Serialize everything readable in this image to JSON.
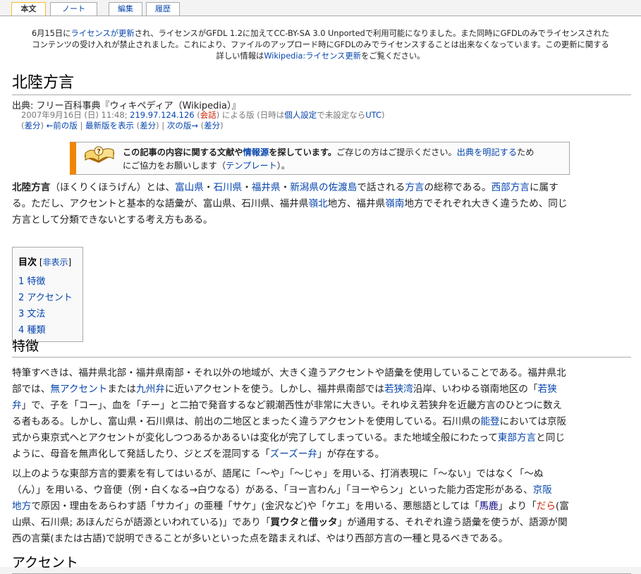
{
  "tabs": [
    {
      "label": "本文",
      "selected": true
    },
    {
      "label": "ノート",
      "selected": false
    },
    {
      "label": "編集",
      "selected": false
    },
    {
      "label": "履歴",
      "selected": false
    }
  ],
  "sitenotice": {
    "l1_a": "6月15日に",
    "l1_link1": "ライセンスが更新",
    "l1_b": "され、ライセンスがGFDL 1.2に加えてCC-BY-SA 3.0 Unportedで利用可能になりました。また同時にGFDLのみでライセンスされた",
    "l2": "コンテンツの受け入れが禁止されました。これにより、ファイルのアップロード時にGFDLのみでライセンスすることは出来なくなっています。この更新に関する",
    "l3_a": "詳しい情報は",
    "l3_link": "Wikipedia:ライセンス更新",
    "l3_b": "をご覧ください。"
  },
  "page": {
    "title": "北陸方言",
    "sitesub": "出典: フリー百科事典『ウィキペディア（Wikipedia）』"
  },
  "revision": {
    "date": "2007年9月16日 (日) 11:48; ",
    "ip": "219.97.124.126",
    "talk_open": " (",
    "talk": "会話",
    "talk_close": ") による版 (日時は",
    "prefs": "個人設定",
    "prefs_after": "で未設定なら",
    "utc": "UTC",
    "close": ")",
    "diff1": "差分",
    "prev": "←前の版",
    "latest": "最新版を表示",
    "diff2": "差分",
    "next": "次の版→",
    "diff3": "差分",
    "nav_a": "(",
    "nav_b": ") ",
    "nav_c": " | ",
    "nav_d": " (",
    "nav_e": ") | ",
    "nav_f": " (",
    "nav_g": ")"
  },
  "ambox": {
    "bold_a": "この記事の内容に関する文献や",
    "bold_link": "情報源",
    "bold_b": "を探しています。",
    "rest": "ご存じの方はご提示ください。",
    "link": "出典を明記する",
    "after_link": "ため",
    "l2_a": "にご協力をお願いします（",
    "l2_link": "テンプレート",
    "l2_b": "）。"
  },
  "intro": {
    "bold": "北陸方言",
    "t1": "（ほくりくほうげん）とは、",
    "k1": "富山県",
    "dot1": "・",
    "k2": "石川県",
    "dot2": "・",
    "k3": "福井県",
    "dot3": "・",
    "k4": "新潟県",
    "no": "の",
    "k5": "佐渡島",
    "t2": "で話される",
    "k6": "方言",
    "t3": "の総称である。",
    "k7": "西部方言",
    "t4": "に属す",
    "l2_a": "る。ただし、アクセントと基本的な語彙が、富山県、石川県、福井県",
    "l2_link1": "嶺北",
    "l2_b": "地方、福井県",
    "l2_link2": "嶺南",
    "l2_c": "地方でそれぞれ大きく違うため、同じ",
    "l3": "方言として分類できないとする考え方もある。"
  },
  "toc": {
    "title": "目次",
    "hide_open": " [",
    "hide": "非表示",
    "hide_close": "]",
    "items": [
      {
        "num": "1",
        "label": "特徴"
      },
      {
        "num": "2",
        "label": "アクセント"
      },
      {
        "num": "3",
        "label": "文法"
      },
      {
        "num": "4",
        "label": "種類"
      }
    ]
  },
  "section1": {
    "heading": "特徴",
    "p1_l1": "特筆すべきは、福井県北部・福井県南部・それ以外の地域が、大きく違うアクセントや語彙を使用していることである。福井県北",
    "p1_l2_a": "部では、",
    "p1_l2_k1": "無アクセント",
    "p1_l2_b": "または",
    "p1_l2_k2": "九州弁",
    "p1_l2_c": "に近いアクセントを使う。しかし、福井県南部では",
    "p1_l2_k3": "若狭湾",
    "p1_l2_d": "沿岸、いわゆる嶺南地区の「",
    "p1_l2_k4": "若狭",
    "p1_l3_k4": "弁",
    "p1_l3_a": "」で、子を「コー」、血を「チー」と二拍で発音するなど親潮西性が非常に大きい。それゆえ若狭弁を近畿方言のひとつに数え",
    "p1_l4": "る者もある。しかし、富山県・石川県は、前出の二地区とまったく違うアクセントを使用している。石川県の",
    "p1_l4_k": "能登",
    "p1_l4_b": "においては京阪",
    "p1_l5_a": "式から東京式へとアクセントが変化しつつあるかあるいは変化が完了してしまっている。また地域全般にわたって",
    "p1_l5_k": "東部方言",
    "p1_l5_b": "と同じ",
    "p1_l6_a": "ように、母音を無声化して発話したり、ジとズを混同する「",
    "p1_l6_k": "ズーズー弁",
    "p1_l6_b": "」が存在する。",
    "p2_l1": "以上のような東部方言的要素を有してはいるが、語尾に「〜や」「〜じゃ」を用いる、打消表現に「〜ない」ではなく「〜ぬ",
    "p2_l2_a": "（ん）」を用いる、ウ音便（例・白くなる→白ウなる）がある、「ヨー言わん」「ヨーやらン」といった能力否定形がある、",
    "p2_l2_k": "京阪",
    "p2_l3_k": "地方",
    "p2_l3_a": "で原因・理由をあらわす語「サカイ」の亜種「サケ」(金沢など)や「ケエ」を用いる、悪態語としては「",
    "p2_l3_k2": "馬鹿",
    "p2_l3_b": "」より「",
    "p2_l3_k3": "だら",
    "p2_l3_c": "(富",
    "p2_l4_a": "山県、石川県; あほんだらが語源といわれている)」であり「",
    "p2_l4_b1": "買ウタ",
    "p2_l4_and": "と",
    "p2_l4_b2": "借ッタ",
    "p2_l4_c": "」が通用する、それぞれ違う語彙を使うが、語源が関",
    "p2_l5": "西の言葉(または古語)で説明できることが多いといった点を踏まえれば、やはり西部方言の一種と見るべきである。"
  },
  "section2": {
    "heading": "アクセント"
  }
}
